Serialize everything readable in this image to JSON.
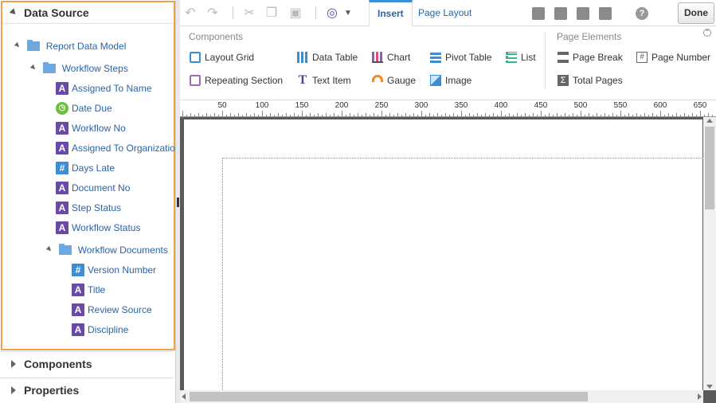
{
  "left_panel": {
    "data_source_title": "Data Source",
    "tree": {
      "root": "Report Data Model",
      "workflow_steps": "Workflow Steps",
      "fields": [
        {
          "icon": "text",
          "label": "Assigned To Name"
        },
        {
          "icon": "date",
          "label": "Date Due"
        },
        {
          "icon": "text",
          "label": "Workflow No"
        },
        {
          "icon": "text",
          "label": "Assigned To Organizatio"
        },
        {
          "icon": "number",
          "label": "Days Late"
        },
        {
          "icon": "text",
          "label": "Document No"
        },
        {
          "icon": "text",
          "label": "Step Status"
        },
        {
          "icon": "text",
          "label": "Workflow Status"
        }
      ],
      "workflow_documents": "Workflow Documents",
      "doc_fields": [
        {
          "icon": "number",
          "label": "Version Number"
        },
        {
          "icon": "text",
          "label": "Title"
        },
        {
          "icon": "text",
          "label": "Review Source"
        },
        {
          "icon": "text",
          "label": "Discipline"
        }
      ]
    },
    "components_section": "Components",
    "properties_section": "Properties"
  },
  "toolbar": {
    "tabs": [
      "Insert",
      "Page Layout"
    ],
    "done_label": "Done",
    "icon_glyphs": {
      "text": "A",
      "number": "#",
      "date": "◷",
      "help": "?"
    }
  },
  "ribbon": {
    "components_title": "Components",
    "components": [
      {
        "label": "Layout Grid",
        "icon": "layout-grid-icon"
      },
      {
        "label": "Data Table",
        "icon": "data-table-icon"
      },
      {
        "label": "Chart",
        "icon": "chart-icon"
      },
      {
        "label": "Pivot Table",
        "icon": "pivot-table-icon"
      },
      {
        "label": "List",
        "icon": "list-icon"
      },
      {
        "label": "Repeating Section",
        "icon": "repeating-section-icon"
      },
      {
        "label": "Text Item",
        "icon": "text-item-icon"
      },
      {
        "label": "Gauge",
        "icon": "gauge-icon"
      },
      {
        "label": "Image",
        "icon": "image-icon"
      }
    ],
    "page_elements_title": "Page Elements",
    "page_elements": [
      {
        "label": "Page Break",
        "icon": "page-break-icon"
      },
      {
        "label": "Page Number",
        "icon": "page-number-icon"
      },
      {
        "label": "Total Pages",
        "icon": "total-pages-icon"
      }
    ]
  },
  "ruler": {
    "labels": [
      "50",
      "100",
      "150",
      "200",
      "250",
      "300",
      "350",
      "400",
      "450",
      "500",
      "550",
      "600",
      "650"
    ]
  },
  "colors": {
    "accent": "#3b8ed6",
    "highlight_border": "#f0a04b",
    "link": "#2a64a8"
  }
}
